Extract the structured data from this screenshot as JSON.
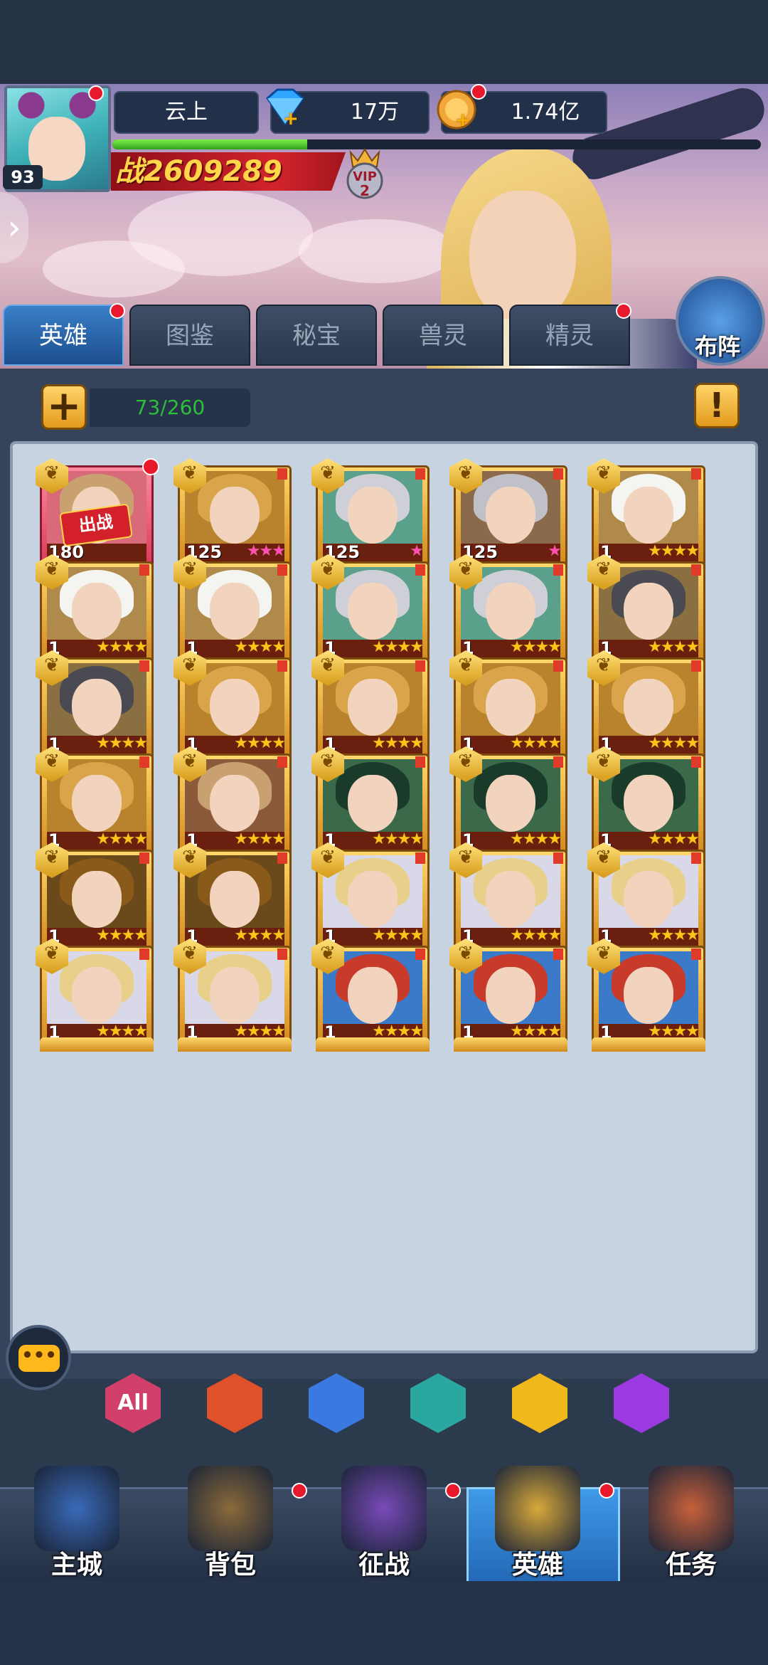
{
  "player": {
    "name": "云上",
    "level": "93",
    "gems": "17万",
    "coins": "1.74亿",
    "power": "战2609289",
    "vip": "VIP",
    "vip_level": "2",
    "exp_fraction": 0.3
  },
  "tabs": [
    {
      "label": "英雄",
      "active": true,
      "dot": true
    },
    {
      "label": "图鉴",
      "active": false,
      "dot": false
    },
    {
      "label": "秘宝",
      "active": false,
      "dot": false
    },
    {
      "label": "兽灵",
      "active": false,
      "dot": false
    },
    {
      "label": "精灵",
      "active": false,
      "dot": true
    }
  ],
  "formation_label": "布阵",
  "hero_count": "73/260",
  "add_icon": "+",
  "info_icon": "!",
  "sortie_label": "出战",
  "heroes": [
    {
      "level": "180",
      "stars": "",
      "hair": "#c9a070",
      "bg": "#d86a7a",
      "special": true,
      "dot": true
    },
    {
      "level": "125",
      "stars": "★★★",
      "pink": true,
      "hair": "#d9a44a",
      "bg": "#b8832c"
    },
    {
      "level": "125",
      "stars": "★",
      "pink": true,
      "hair": "#cfcfd8",
      "bg": "#5aa08a"
    },
    {
      "level": "125",
      "stars": "★",
      "pink": true,
      "hair": "#c0c0c8",
      "bg": "#8a6a4a"
    },
    {
      "level": "1",
      "stars": "★★★★",
      "hair": "#f4f4f0",
      "bg": "#b08a4a"
    },
    {
      "level": "1",
      "stars": "★★★★",
      "hair": "#f4f4f0",
      "bg": "#b08a4a"
    },
    {
      "level": "1",
      "stars": "★★★★",
      "hair": "#f4f4f0",
      "bg": "#b08a4a"
    },
    {
      "level": "1",
      "stars": "★★★★",
      "hair": "#cfcfd8",
      "bg": "#5aa08a"
    },
    {
      "level": "1",
      "stars": "★★★★",
      "hair": "#cfcfd8",
      "bg": "#5aa08a"
    },
    {
      "level": "1",
      "stars": "★★★★",
      "hair": "#4a4a52",
      "bg": "#8a7040"
    },
    {
      "level": "1",
      "stars": "★★★★",
      "hair": "#4a4a52",
      "bg": "#8a7040"
    },
    {
      "level": "1",
      "stars": "★★★★",
      "hair": "#d9a44a",
      "bg": "#b8832c"
    },
    {
      "level": "1",
      "stars": "★★★★",
      "hair": "#d9a44a",
      "bg": "#b8832c"
    },
    {
      "level": "1",
      "stars": "★★★★",
      "hair": "#d9a44a",
      "bg": "#b8832c"
    },
    {
      "level": "1",
      "stars": "★★★★",
      "hair": "#d9a44a",
      "bg": "#b8832c"
    },
    {
      "level": "1",
      "stars": "★★★★",
      "hair": "#d9a44a",
      "bg": "#b8832c"
    },
    {
      "level": "1",
      "stars": "★★★★",
      "hair": "#c9a070",
      "bg": "#8a5a3a"
    },
    {
      "level": "1",
      "stars": "★★★★",
      "hair": "#1a3a2a",
      "bg": "#3a6a4a"
    },
    {
      "level": "1",
      "stars": "★★★★",
      "hair": "#1a3a2a",
      "bg": "#3a6a4a"
    },
    {
      "level": "1",
      "stars": "★★★★",
      "hair": "#1a3a2a",
      "bg": "#3a6a4a"
    },
    {
      "level": "1",
      "stars": "★★★★",
      "hair": "#8a5a1a",
      "bg": "#6a4a1a"
    },
    {
      "level": "1",
      "stars": "★★★★",
      "hair": "#8a5a1a",
      "bg": "#6a4a1a"
    },
    {
      "level": "1",
      "stars": "★★★★",
      "hair": "#e8d08a",
      "bg": "#d8d8e8"
    },
    {
      "level": "1",
      "stars": "★★★★",
      "hair": "#e8d08a",
      "bg": "#d8d8e8"
    },
    {
      "level": "1",
      "stars": "★★★★",
      "hair": "#e8d08a",
      "bg": "#d8d8e8"
    },
    {
      "level": "1",
      "stars": "★★★★",
      "hair": "#e8d08a",
      "bg": "#d8d8e8"
    },
    {
      "level": "1",
      "stars": "★★★★",
      "hair": "#e8d08a",
      "bg": "#d8d8e8"
    },
    {
      "level": "1",
      "stars": "★★★★",
      "hair": "#c83a2a",
      "bg": "#3a7ac8"
    },
    {
      "level": "1",
      "stars": "★★★★",
      "hair": "#c83a2a",
      "bg": "#3a7ac8"
    },
    {
      "level": "1",
      "stars": "★★★★",
      "hair": "#c83a2a",
      "bg": "#3a7ac8"
    }
  ],
  "filters": [
    {
      "label": "All",
      "icon": "all-factions-icon",
      "color": "#d0406a"
    },
    {
      "label": "",
      "icon": "fire-faction-icon",
      "color": "#e0502a"
    },
    {
      "label": "",
      "icon": "cross-faction-icon",
      "color": "#3a7ae0"
    },
    {
      "label": "",
      "icon": "skull-faction-icon",
      "color": "#2aa8a0"
    },
    {
      "label": "",
      "icon": "leaf-faction-icon",
      "color": "#f0b81a"
    },
    {
      "label": "",
      "icon": "demon-faction-icon",
      "color": "#9a3ae0"
    }
  ],
  "nav": [
    {
      "label": "主城",
      "icon": "castle-icon",
      "dot": false,
      "active": false,
      "color": "#3a6ab8"
    },
    {
      "label": "背包",
      "icon": "chest-icon",
      "dot": true,
      "active": false,
      "color": "#8a6a3a"
    },
    {
      "label": "征战",
      "icon": "portal-icon",
      "dot": true,
      "active": false,
      "color": "#7a4ab8"
    },
    {
      "label": "英雄",
      "icon": "helmet-icon",
      "dot": true,
      "active": true,
      "color": "#d8a83a"
    },
    {
      "label": "任务",
      "icon": "scroll-icon",
      "dot": false,
      "active": false,
      "color": "#c8603a"
    }
  ]
}
